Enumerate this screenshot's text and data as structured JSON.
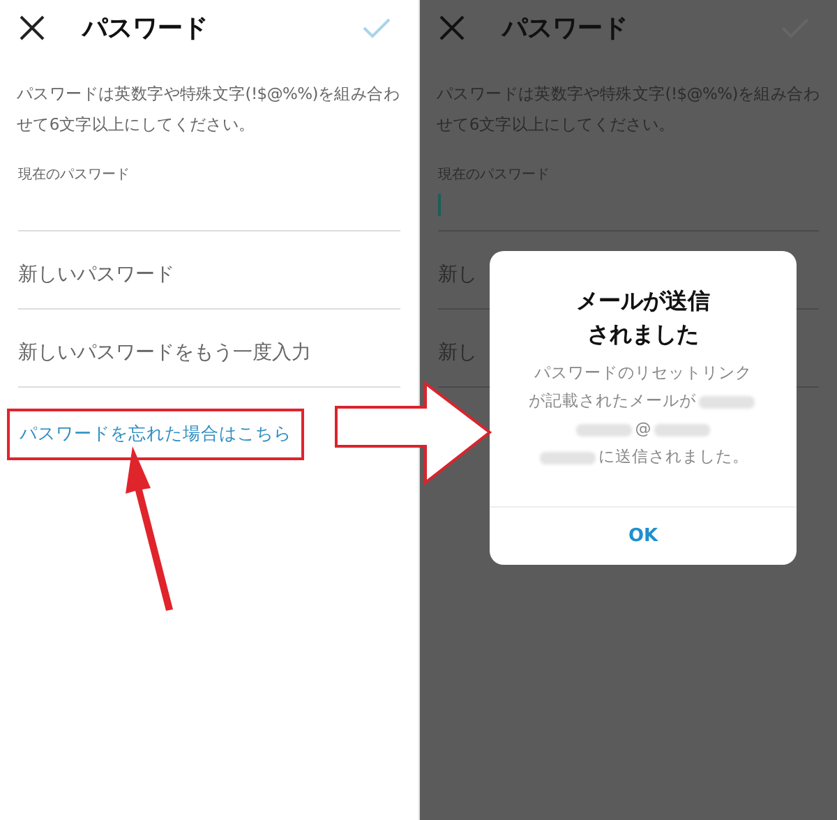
{
  "panels": [
    {
      "dimmed": false,
      "header": {
        "title": "パスワード"
      },
      "description": "パスワードは英数字や特殊文字(!$@%%)を組み合わせて6文字以上にしてください。",
      "fields": [
        {
          "kind": "labeled",
          "label": "現在のパスワード",
          "focused": false
        },
        {
          "kind": "plain",
          "placeholder": "新しいパスワード"
        },
        {
          "kind": "plain",
          "placeholder": "新しいパスワードをもう一度入力"
        }
      ],
      "link": {
        "text": "パスワードを忘れた場合はこちら",
        "highlighted": true
      }
    },
    {
      "dimmed": true,
      "header": {
        "title": "パスワード"
      },
      "description": "パスワードは英数字や特殊文字(!$@%%)を組み合わせて6文字以上にしてください。",
      "fields": [
        {
          "kind": "labeled",
          "label": "現在のパスワード",
          "focused": true
        },
        {
          "kind": "plain",
          "placeholder": "新し"
        },
        {
          "kind": "plain",
          "placeholder": "新し"
        }
      ],
      "dialog": {
        "title": [
          "メールが送信",
          "されました"
        ],
        "lines": [
          [
            {
              "kind": "text",
              "text": "パスワードのリセットリンク"
            }
          ],
          [
            {
              "kind": "text",
              "text": "が記載されたメールが"
            },
            {
              "kind": "redacted"
            }
          ],
          [
            {
              "kind": "redacted"
            },
            {
              "kind": "text",
              "text": "@"
            },
            {
              "kind": "redacted"
            }
          ],
          [
            {
              "kind": "redacted"
            },
            {
              "kind": "text",
              "text": "に送信されました。"
            }
          ]
        ],
        "button": "OK"
      }
    }
  ]
}
